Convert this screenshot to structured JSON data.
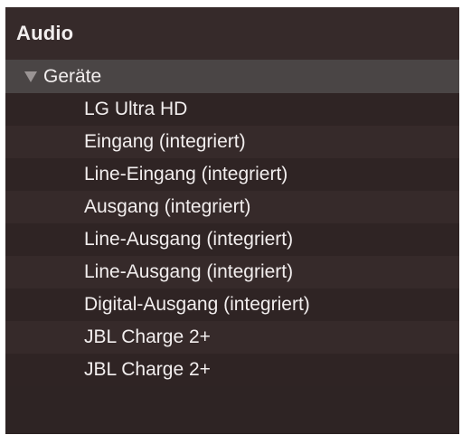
{
  "panel": {
    "title": "Audio"
  },
  "group": {
    "label": "Geräte",
    "expanded": true,
    "icon": "disclosure-triangle-down-icon"
  },
  "devices": [
    {
      "label": "LG Ultra HD"
    },
    {
      "label": "Eingang (integriert)"
    },
    {
      "label": "Line-Eingang (integriert)"
    },
    {
      "label": "Ausgang (integriert)"
    },
    {
      "label": "Line-Ausgang (integriert)"
    },
    {
      "label": "Line-Ausgang (integriert)"
    },
    {
      "label": "Digital-Ausgang (integriert)"
    },
    {
      "label": "JBL Charge 2+"
    },
    {
      "label": "JBL Charge 2+"
    }
  ],
  "colors": {
    "background": "#2e2424",
    "row_alt": "#362a2a",
    "group_row": "#4a4545",
    "text": "#f2eeee",
    "triangle": "#9a9494"
  }
}
